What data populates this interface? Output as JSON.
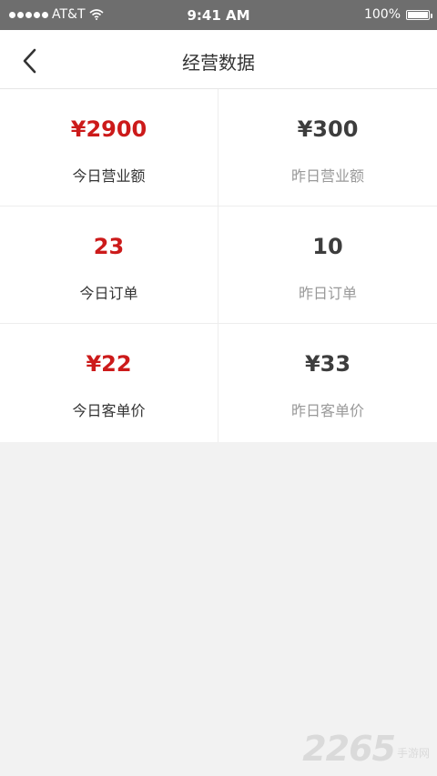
{
  "status_bar": {
    "carrier": "AT&T",
    "time": "9:41 AM",
    "battery": "100%",
    "wifi_icon": "wifi-icon",
    "battery_icon": "battery-icon",
    "signal_icon": "signal-dots-icon"
  },
  "nav": {
    "title": "经营数据",
    "back_icon": "chevron-left-icon"
  },
  "stats": [
    {
      "today_value": "¥2900",
      "today_label": "今日营业额",
      "yesterday_value": "¥300",
      "yesterday_label": "昨日营业额"
    },
    {
      "today_value": "23",
      "today_label": "今日订单",
      "yesterday_value": "10",
      "yesterday_label": "昨日订单"
    },
    {
      "today_value": "¥22",
      "today_label": "今日客单价",
      "yesterday_value": "¥33",
      "yesterday_label": "昨日客单价"
    }
  ],
  "colors": {
    "accent_red": "#cc1a1a",
    "yesterday_value": "#3d3d3d",
    "muted_label": "#999999",
    "status_bar_bg": "#6e6e6e",
    "page_bg": "#f2f2f2"
  },
  "watermark": {
    "number": "2265",
    "text": "手游网"
  }
}
